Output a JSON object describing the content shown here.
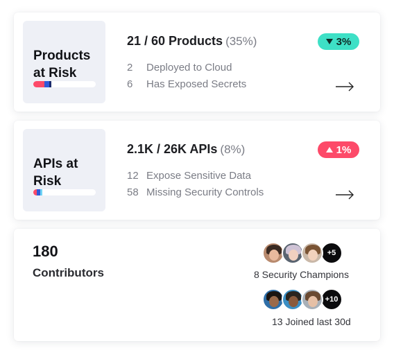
{
  "cards": [
    {
      "tile_title": "Products at Risk",
      "headline": "21 / 60 Products",
      "headline_pct": "(35%)",
      "rows": [
        {
          "num": "2",
          "label": "Deployed to Cloud"
        },
        {
          "num": "6",
          "label": "Has Exposed Secrets"
        }
      ],
      "badge": {
        "direction": "down",
        "value": "3%",
        "color": "#3ee0c6"
      },
      "risk_bar_segments": [
        {
          "color": "#fd4a69",
          "fraction": 0.18
        },
        {
          "color": "#2f5bd9",
          "fraction": 0.08
        },
        {
          "color": "#1a2b6d",
          "fraction": 0.03
        }
      ],
      "action_icon": "arrow-right-icon"
    },
    {
      "tile_title": "APIs at Risk",
      "headline": "2.1K / 26K APIs",
      "headline_pct": "(8%)",
      "rows": [
        {
          "num": "12",
          "label": "Expose Sensitive Data"
        },
        {
          "num": "58",
          "label": "Missing Security Controls"
        }
      ],
      "badge": {
        "direction": "up",
        "value": "1%",
        "color": "#fd4a69"
      },
      "risk_bar_segments": [
        {
          "color": "#fd4a69",
          "fraction": 0.05
        },
        {
          "color": "#2f5bd9",
          "fraction": 0.05
        },
        {
          "color": "#6fd3f5",
          "fraction": 0.03
        }
      ],
      "action_icon": "arrow-right-icon"
    }
  ],
  "contributors": {
    "count": "180",
    "label": "Contributors",
    "champions": {
      "more": "+5",
      "caption": "8 Security Champions"
    },
    "joined": {
      "more": "+10",
      "caption": "13 Joined last 30d"
    }
  }
}
